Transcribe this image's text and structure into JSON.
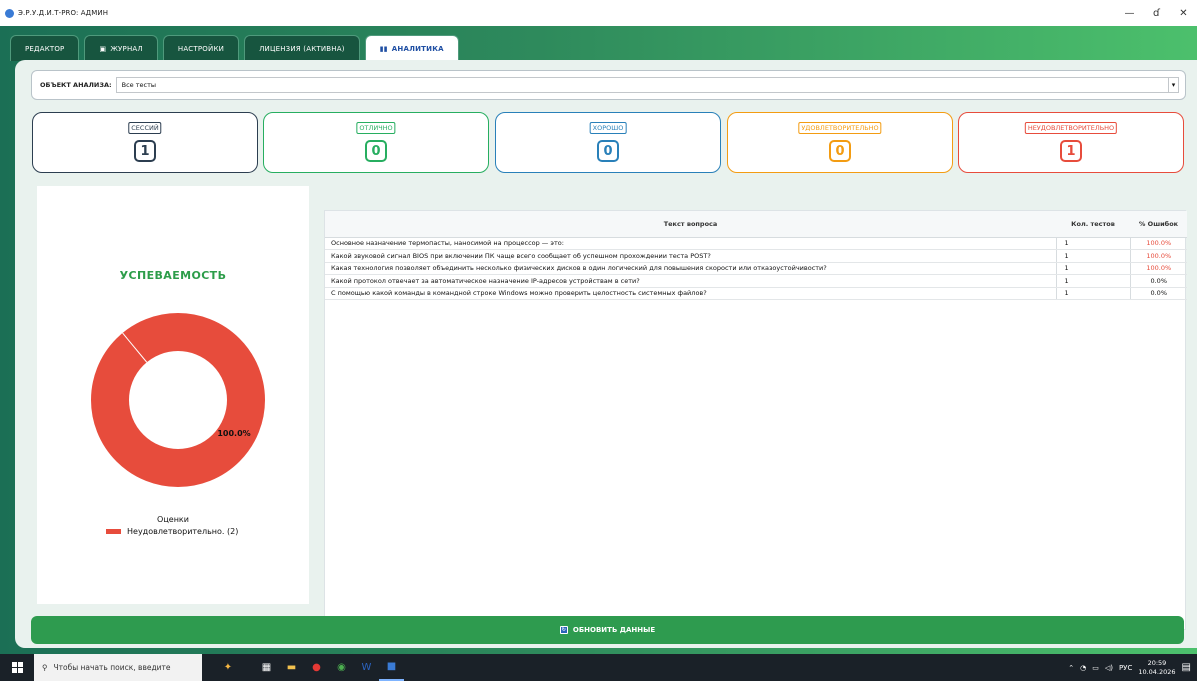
{
  "window": {
    "title": "Э.Р.У.Д.И.Т-PRO: АДМИН",
    "minimize": "—",
    "maximize": "ɗ",
    "close": "✕"
  },
  "tabs": [
    {
      "label": "РЕДАКТОР",
      "icon": ""
    },
    {
      "label": "ЖУРНАЛ",
      "icon": "▣"
    },
    {
      "label": "НАСТРОЙКИ",
      "icon": ""
    },
    {
      "label": "ЛИЦЕНЗИЯ (АКТИВНА)",
      "icon": ""
    },
    {
      "label": "АНАЛИТИКА",
      "icon": "▮▮"
    }
  ],
  "analysis": {
    "label": "ОБЪЕКТ АНАЛИЗА:",
    "selected": "Все тесты"
  },
  "stats": [
    {
      "label": "СЕССИЙ",
      "value": "1",
      "color": "#2c3e50"
    },
    {
      "label": "ОТЛИЧНО",
      "value": "0",
      "color": "#27ae60"
    },
    {
      "label": "ХОРОШО",
      "value": "0",
      "color": "#2980b9"
    },
    {
      "label": "УДОВЛЕТВОРИТЕЛЬНО",
      "value": "0",
      "color": "#f39c12"
    },
    {
      "label": "НЕУДОВЛЕТВОРИТЕЛЬНО",
      "value": "1",
      "color": "#e74c3c"
    }
  ],
  "chart": {
    "title": "УСПЕВАЕМОСТЬ",
    "legend_title": "Оценки",
    "legend_item": "Неудовлетворительно. (2)",
    "slice_label": "100.0%"
  },
  "chart_data": {
    "type": "pie",
    "title": "УСПЕВАЕМОСТЬ",
    "categories": [
      "Неудовлетворительно. (2)"
    ],
    "values": [
      100.0
    ],
    "colors": [
      "#e74c3c"
    ],
    "legend_title": "Оценки",
    "legend_position": "bottom"
  },
  "table": {
    "headers": [
      "Текст вопроса",
      "Кол. тестов",
      "% Ошибок"
    ],
    "rows": [
      {
        "question": "Основное назначение термопасты, наносимой на процессор — это:",
        "count": "1",
        "errors": "100.0%"
      },
      {
        "question": "Какой звуковой сигнал BIOS при включении ПК чаще всего сообщает об успешном прохождении теста POST?",
        "count": "1",
        "errors": "100.0%"
      },
      {
        "question": "Какая технология позволяет объединить несколько физических дисков в один логический для повышения скорости или отказоустойчивости?",
        "count": "1",
        "errors": "100.0%"
      },
      {
        "question": "Какой протокол отвечает за автоматическое назначение IP-адресов устройствам в сети?",
        "count": "1",
        "errors": "0.0%"
      },
      {
        "question": "С помощью какой команды в командной строке Windows можно проверить целостность системных файлов?",
        "count": "1",
        "errors": "0.0%"
      }
    ]
  },
  "refresh_button": {
    "label": "ОБНОВИТЬ ДАННЫЕ",
    "icon": "refresh-icon"
  },
  "taskbar": {
    "search_placeholder": "Чтобы начать поиск, введите",
    "lang": "РУС",
    "time": "20:59",
    "date": "10.04.2026"
  }
}
